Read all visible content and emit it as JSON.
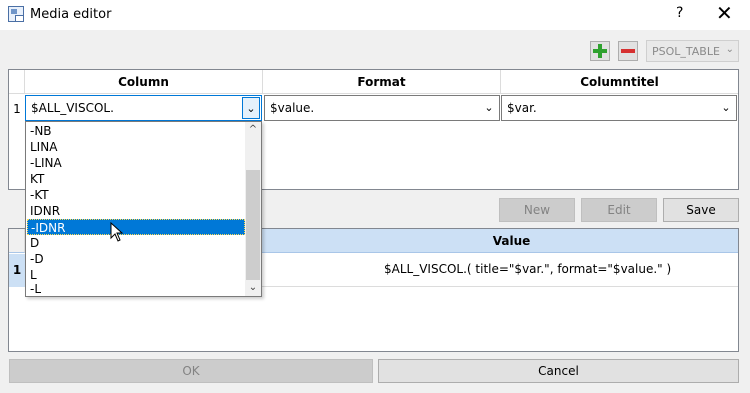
{
  "window": {
    "title": "Media editor",
    "help": "?",
    "close": "✕"
  },
  "toolbar": {
    "table_select": "PSOL_TABLE",
    "chevron": "⌄"
  },
  "grid": {
    "headers": [
      "Column",
      "Format",
      "Columntitel"
    ],
    "row": {
      "number": "1",
      "column": "$ALL_VISCOL.",
      "format": "$value.",
      "title": "$var."
    }
  },
  "dropdown": {
    "items": [
      "-NB",
      "LINA",
      "-LINA",
      "KT",
      "-KT",
      "IDNR",
      "-IDNR",
      "D",
      "-D",
      "L",
      "-L"
    ],
    "selected": "-IDNR"
  },
  "buttons": {
    "new": "New",
    "edit": "Edit",
    "save": "Save",
    "ok": "OK",
    "cancel": "Cancel"
  },
  "result_grid": {
    "header_value": "Value",
    "row": {
      "number": "1",
      "value": "$ALL_VISCOL.( title=\"$var.\", format=\"$value.\" )"
    }
  },
  "colors": {
    "accent": "#0078d7",
    "header_blue": "#cce0f5",
    "plus": "#2ea12e",
    "minus": "#d63030"
  }
}
